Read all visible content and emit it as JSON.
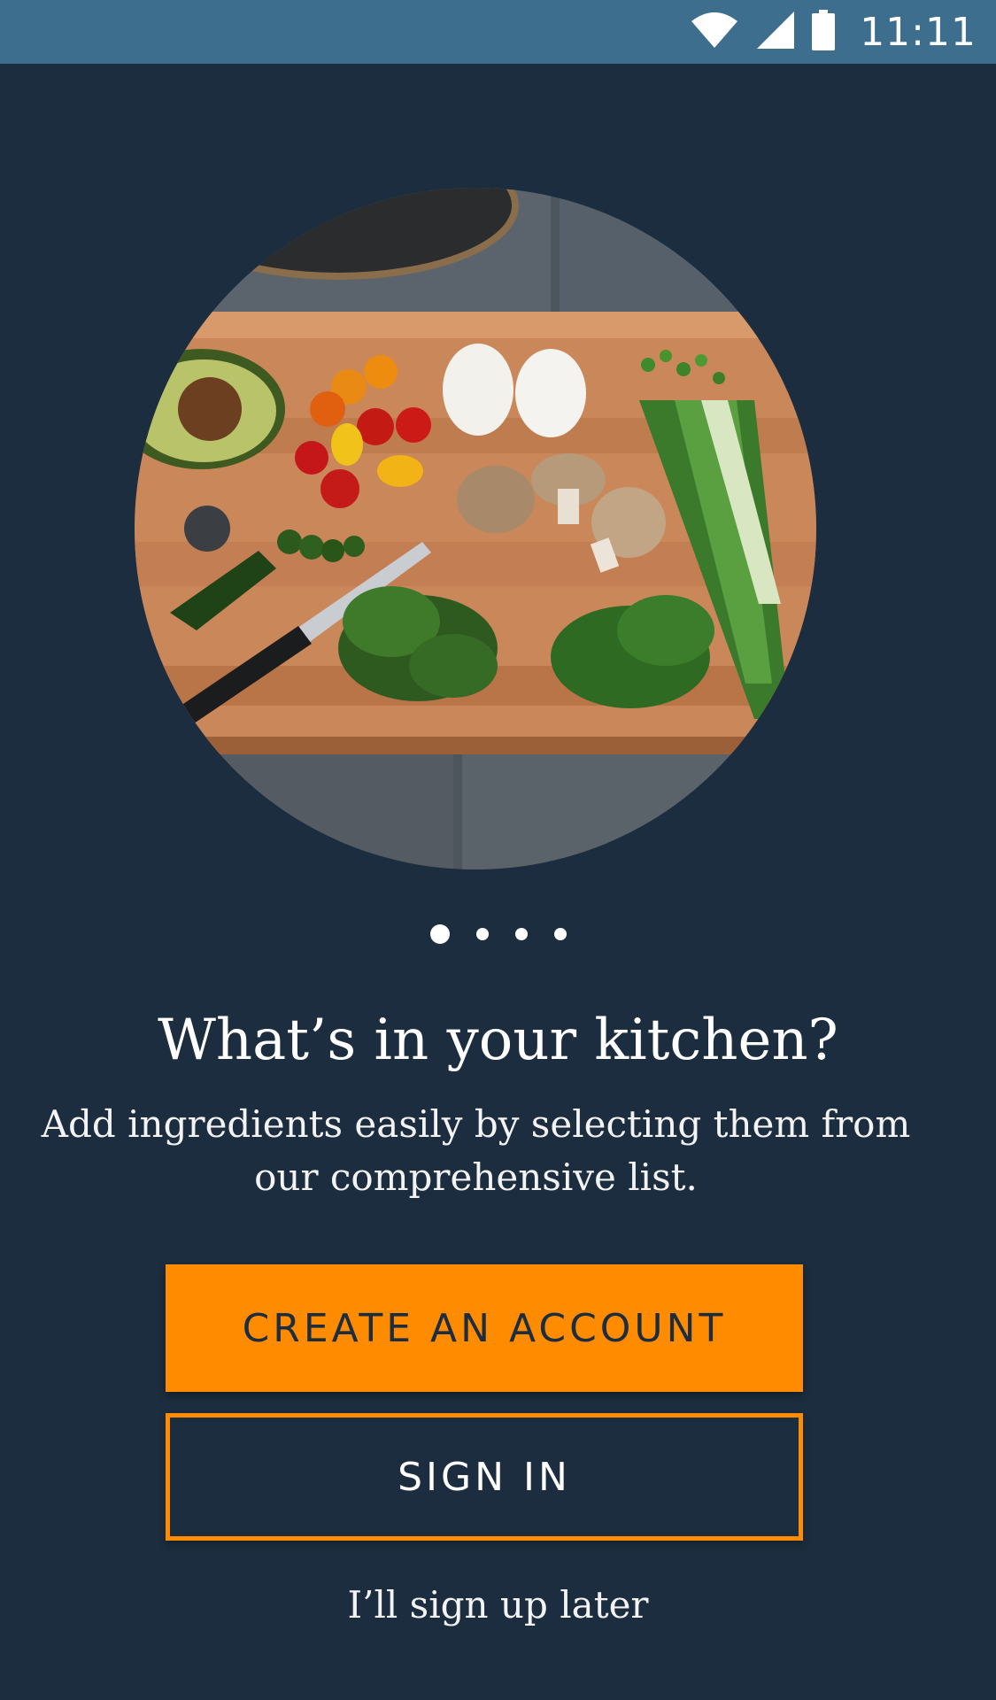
{
  "status_bar": {
    "time": "11:11",
    "icons": [
      "wifi-icon",
      "cell-signal-icon",
      "battery-icon"
    ],
    "background": "#3e6e8e"
  },
  "hero": {
    "image": "cutting-board-vegetables-photo"
  },
  "pager": {
    "page_count": 4,
    "active_index": 0
  },
  "onboarding": {
    "title": "What’s in your kitchen?",
    "subtitle": "Add ingredients easily by selecting them from our comprehensive list."
  },
  "actions": {
    "create_account_label": "CREATE AN ACCOUNT",
    "sign_in_label": "SIGN IN",
    "later_label": "I’ll sign up later"
  },
  "colors": {
    "background": "#1b2d3e",
    "accent": "#ff8c00"
  }
}
